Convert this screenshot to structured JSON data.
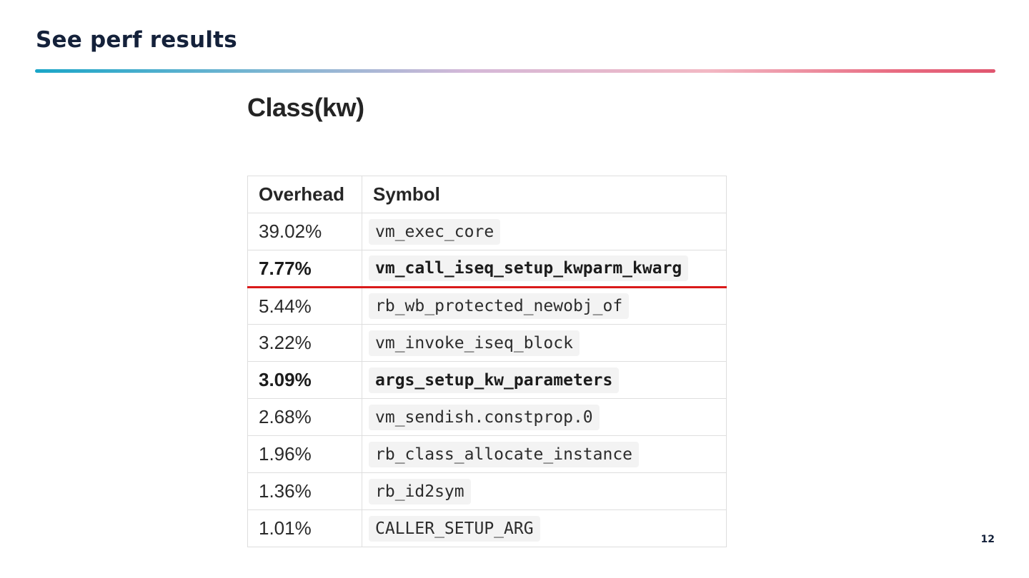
{
  "slide": {
    "title": "See perf results",
    "page_number": "12"
  },
  "section": {
    "heading": "Class(kw)"
  },
  "table": {
    "headers": {
      "overhead": "Overhead",
      "symbol": "Symbol"
    },
    "rows": [
      {
        "overhead": "39.02%",
        "symbol": "vm_exec_core",
        "bold": false,
        "highlight": false
      },
      {
        "overhead": "7.77%",
        "symbol": "vm_call_iseq_setup_kwparm_kwarg",
        "bold": true,
        "highlight": true
      },
      {
        "overhead": "5.44%",
        "symbol": "rb_wb_protected_newobj_of",
        "bold": false,
        "highlight": false
      },
      {
        "overhead": "3.22%",
        "symbol": "vm_invoke_iseq_block",
        "bold": false,
        "highlight": false
      },
      {
        "overhead": "3.09%",
        "symbol": "args_setup_kw_parameters",
        "bold": true,
        "highlight": false
      },
      {
        "overhead": "2.68%",
        "symbol": "vm_sendish.constprop.0",
        "bold": false,
        "highlight": false
      },
      {
        "overhead": "1.96%",
        "symbol": "rb_class_allocate_instance",
        "bold": false,
        "highlight": false
      },
      {
        "overhead": "1.36%",
        "symbol": "rb_id2sym",
        "bold": false,
        "highlight": false
      },
      {
        "overhead": "1.01%",
        "symbol": "CALLER_SETUP_ARG",
        "bold": false,
        "highlight": false
      }
    ]
  },
  "colors": {
    "title": "#14213a",
    "highlight_line": "#d91a1a",
    "rule_start": "#1aa6c8",
    "rule_end": "#e0566f"
  }
}
